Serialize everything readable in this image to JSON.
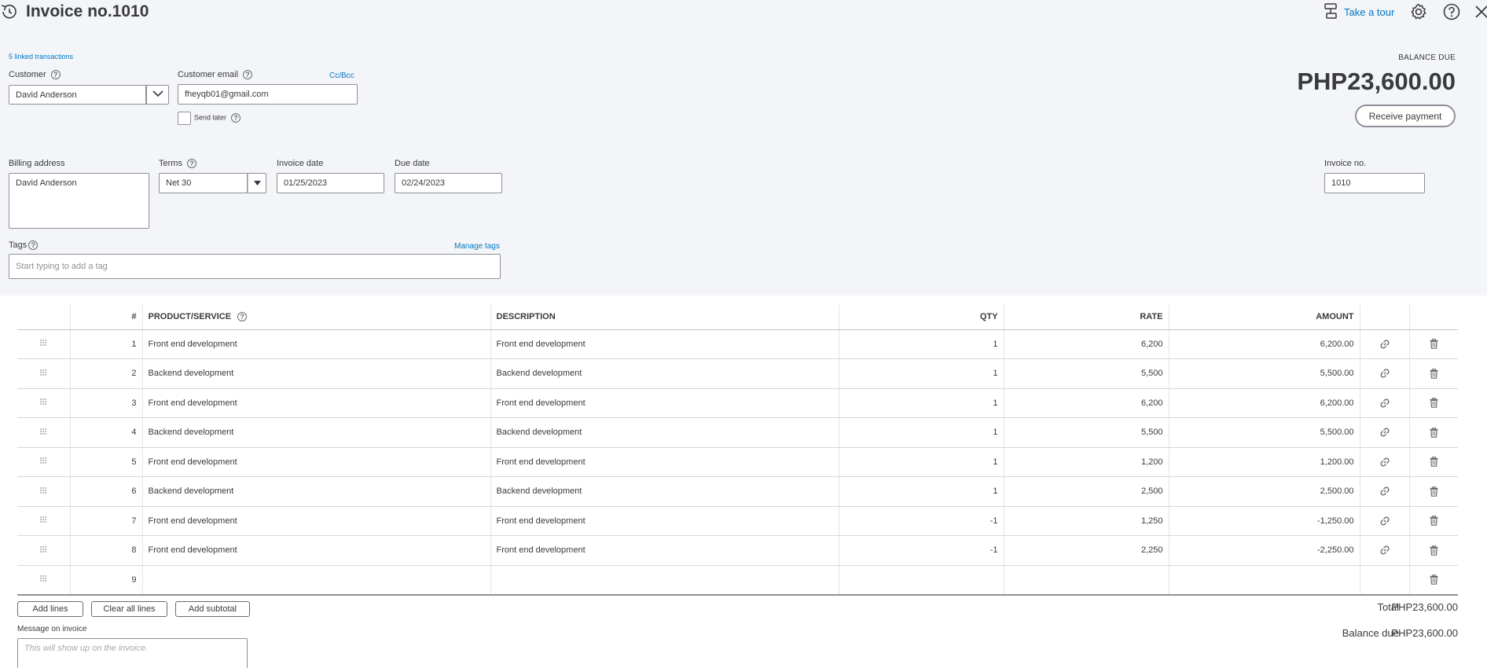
{
  "header": {
    "title": "Invoice no.1010",
    "take_tour": "Take a tour"
  },
  "linked_transactions": "5 linked transactions",
  "customer": {
    "label": "Customer",
    "value": "David Anderson"
  },
  "email": {
    "label": "Customer email",
    "value": "fheyqb01@gmail.com",
    "cc_bcc": "Cc/Bcc",
    "send_later": "Send later"
  },
  "balance": {
    "label": "BALANCE DUE",
    "amount": "PHP23,600.00",
    "receive_payment": "Receive payment"
  },
  "billing": {
    "label": "Billing address",
    "value": "David Anderson"
  },
  "terms": {
    "label": "Terms",
    "value": "Net 30"
  },
  "invoice_date": {
    "label": "Invoice date",
    "value": "01/25/2023"
  },
  "due_date": {
    "label": "Due date",
    "value": "02/24/2023"
  },
  "invoice_no": {
    "label": "Invoice no.",
    "value": "1010"
  },
  "tags": {
    "label": "Tags",
    "manage": "Manage tags",
    "placeholder": "Start typing to add a tag"
  },
  "table": {
    "headers": {
      "num": "#",
      "product": "PRODUCT/SERVICE",
      "description": "DESCRIPTION",
      "qty": "QTY",
      "rate": "RATE",
      "amount": "AMOUNT"
    },
    "rows": [
      {
        "num": "1",
        "product": "Front end development",
        "description": "Front end development",
        "qty": "1",
        "rate": "6,200",
        "amount": "6,200.00"
      },
      {
        "num": "2",
        "product": "Backend development",
        "description": "Backend development",
        "qty": "1",
        "rate": "5,500",
        "amount": "5,500.00"
      },
      {
        "num": "3",
        "product": "Front end development",
        "description": "Front end development",
        "qty": "1",
        "rate": "6,200",
        "amount": "6,200.00"
      },
      {
        "num": "4",
        "product": "Backend development",
        "description": "Backend development",
        "qty": "1",
        "rate": "5,500",
        "amount": "5,500.00"
      },
      {
        "num": "5",
        "product": "Front end development",
        "description": "Front end development",
        "qty": "1",
        "rate": "1,200",
        "amount": "1,200.00"
      },
      {
        "num": "6",
        "product": "Backend development",
        "description": "Backend development",
        "qty": "1",
        "rate": "2,500",
        "amount": "2,500.00"
      },
      {
        "num": "7",
        "product": "Front end development",
        "description": "Front end development",
        "qty": "-1",
        "rate": "1,250",
        "amount": "-1,250.00"
      },
      {
        "num": "8",
        "product": "Front end development",
        "description": "Front end development",
        "qty": "-1",
        "rate": "2,250",
        "amount": "-2,250.00"
      },
      {
        "num": "9",
        "product": "",
        "description": "",
        "qty": "",
        "rate": "",
        "amount": ""
      }
    ]
  },
  "buttons": {
    "add_lines": "Add lines",
    "clear_all_lines": "Clear all lines",
    "add_subtotal": "Add subtotal"
  },
  "totals": {
    "total_label": "Total",
    "total_value": "PHP23,600.00",
    "balance_label": "Balance due",
    "balance_value": "PHP23,600.00"
  },
  "message": {
    "label": "Message on invoice",
    "placeholder": "This will show up on the invoice."
  },
  "colors": {
    "link": "#0077c5",
    "text": "#393a3d",
    "panel_bg": "#f4f5f8",
    "border": "#8d9096"
  },
  "icons": [
    "history-icon",
    "tour-icon",
    "gear-icon",
    "help-icon",
    "close-icon",
    "chevron-down-icon",
    "caret-down-icon",
    "drag-handle-icon",
    "link-icon",
    "trash-icon",
    "question-icon"
  ]
}
